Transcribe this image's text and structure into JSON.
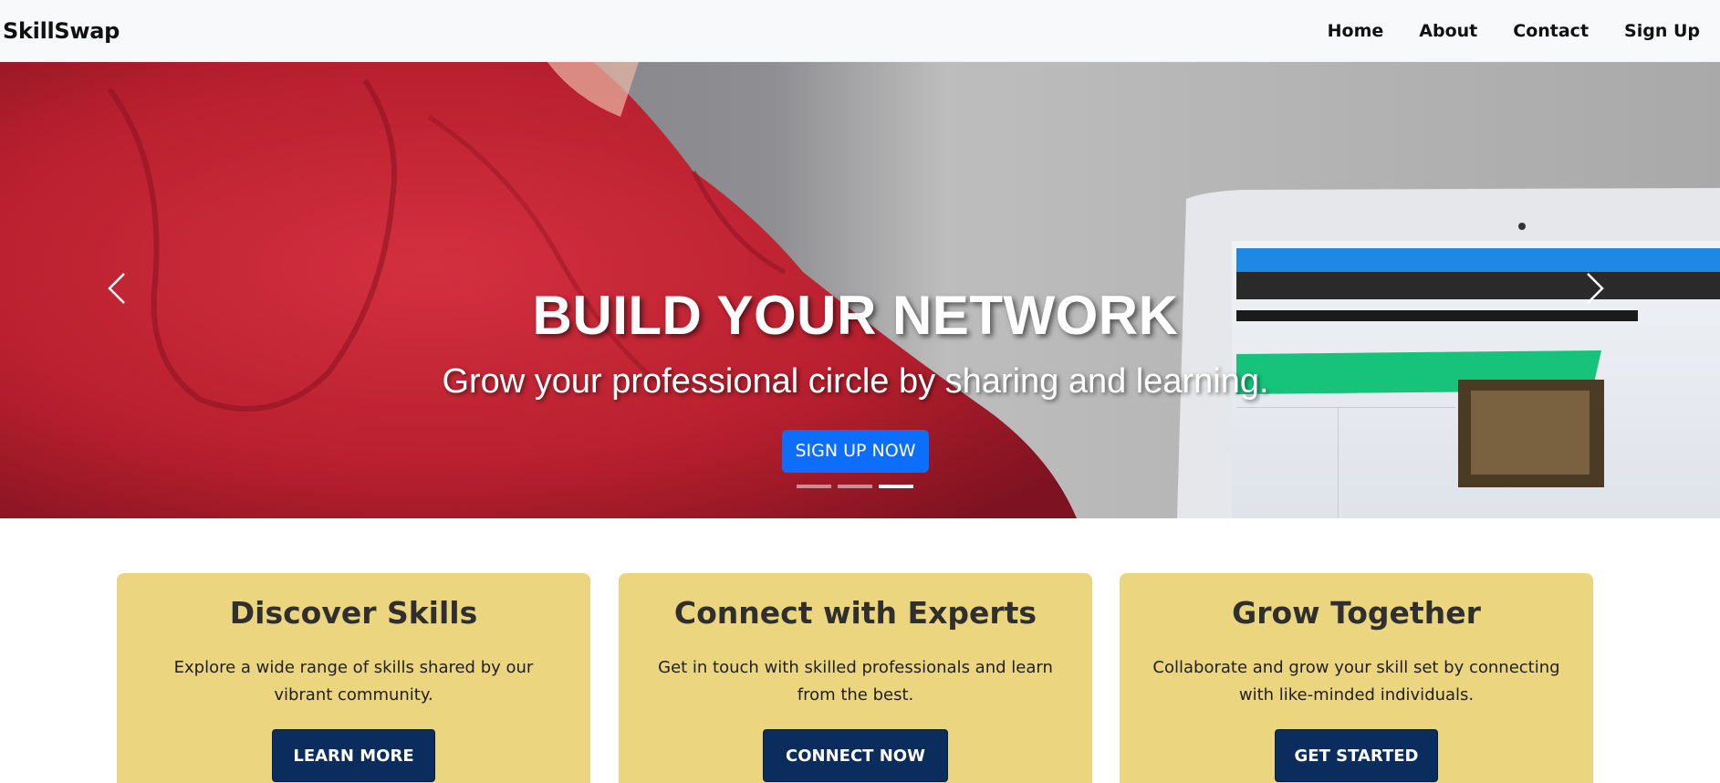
{
  "navbar": {
    "brand": "SkillSwap",
    "links": [
      "Home",
      "About",
      "Contact",
      "Sign Up"
    ]
  },
  "hero": {
    "title": "BUILD YOUR NETWORK",
    "subtitle": "Grow your professional circle by sharing and learning.",
    "cta_label": "SIGN UP NOW",
    "prev_icon": "chevron-left-icon",
    "next_icon": "chevron-right-icon",
    "slide_count": 3,
    "active_slide": 3,
    "accent_color": "#0d6efd",
    "image_description": "person in red hoodie in front of a laptop"
  },
  "features": [
    {
      "title": "Discover Skills",
      "text": "Explore a wide range of skills shared by our vibrant community.",
      "button": "LEARN MORE"
    },
    {
      "title": "Connect with Experts",
      "text": "Get in touch with skilled professionals and learn from the best.",
      "button": "CONNECT NOW"
    },
    {
      "title": "Grow Together",
      "text": "Collaborate and grow your skill set by connecting with like-minded individuals.",
      "button": "GET STARTED"
    }
  ],
  "colors": {
    "card_background": "#ecd57f",
    "card_button": "#0b2d5e",
    "navbar_background": "#f8f9fa"
  }
}
